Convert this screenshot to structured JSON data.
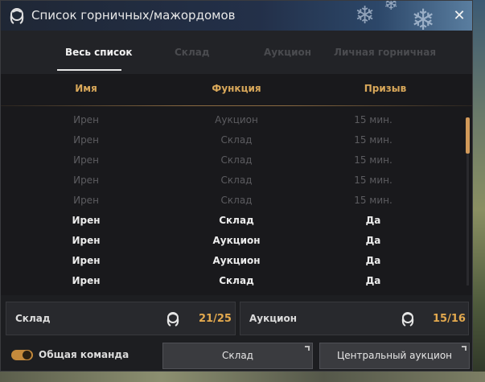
{
  "window": {
    "title": "Список горничных/мажордомов",
    "close_icon": "close-icon"
  },
  "tabs": [
    {
      "label": "Весь список",
      "active": true
    },
    {
      "label": "Склад",
      "active": false
    },
    {
      "label": "Аукцион",
      "active": false
    },
    {
      "label": "Личная горничная",
      "active": false
    }
  ],
  "table": {
    "headers": {
      "name": "Имя",
      "function": "Функция",
      "summon": "Призыв"
    },
    "rows": [
      {
        "name": "Ирен",
        "function": "Аукцион",
        "summon": "15 мин.",
        "available": false
      },
      {
        "name": "Ирен",
        "function": "Склад",
        "summon": "15 мин.",
        "available": false
      },
      {
        "name": "Ирен",
        "function": "Склад",
        "summon": "15 мин.",
        "available": false
      },
      {
        "name": "Ирен",
        "function": "Склад",
        "summon": "15 мин.",
        "available": false
      },
      {
        "name": "Ирен",
        "function": "Склад",
        "summon": "15 мин.",
        "available": false
      },
      {
        "name": "Ирен",
        "function": "Склад",
        "summon": "Да",
        "available": true
      },
      {
        "name": "Ирен",
        "function": "Аукцион",
        "summon": "Да",
        "available": true
      },
      {
        "name": "Ирен",
        "function": "Аукцион",
        "summon": "Да",
        "available": true
      },
      {
        "name": "Ирен",
        "function": "Склад",
        "summon": "Да",
        "available": true
      }
    ]
  },
  "stats": {
    "storage": {
      "label": "Склад",
      "value": "21/25",
      "icon": "maid-icon"
    },
    "auction": {
      "label": "Аукцион",
      "value": "15/16",
      "icon": "maid-icon"
    }
  },
  "footer": {
    "toggle_label": "Общая команда",
    "toggle_on": true,
    "storage_button": "Склад",
    "auction_button": "Центральный аукцион"
  },
  "colors": {
    "accent": "#d9a85a",
    "value": "#e3a94e",
    "background": "#1d1e21"
  }
}
